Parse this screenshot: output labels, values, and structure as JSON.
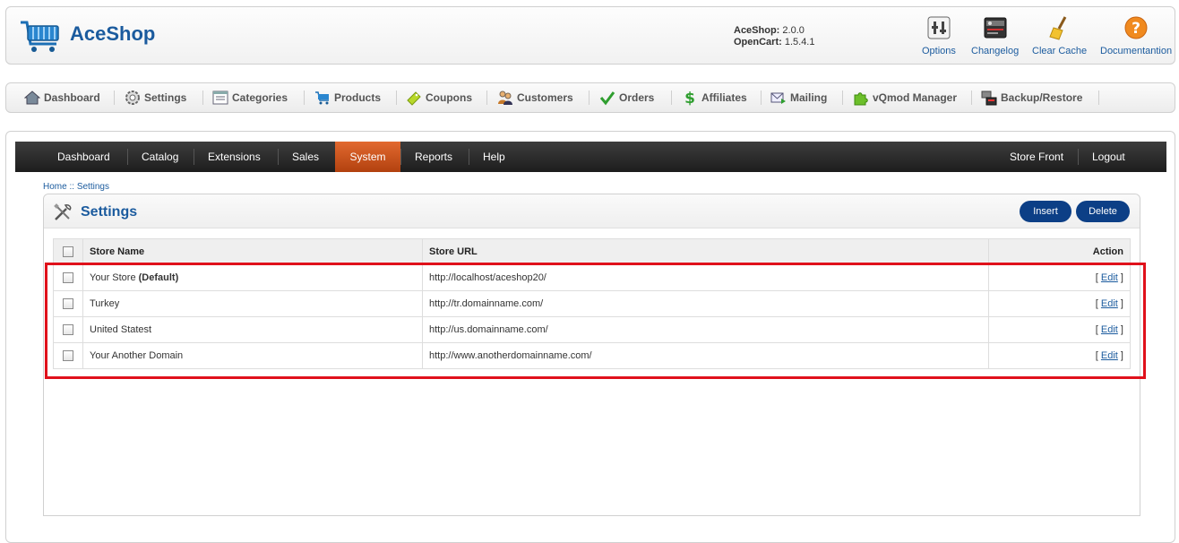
{
  "header": {
    "app_name": "AceShop",
    "aceshop_label": "AceShop:",
    "aceshop_version": "2.0.0",
    "opencart_label": "OpenCart:",
    "opencart_version": "1.5.4.1",
    "buttons": [
      {
        "label": "Options",
        "icon": "options-icon"
      },
      {
        "label": "Changelog",
        "icon": "changelog-icon"
      },
      {
        "label": "Clear Cache",
        "icon": "broom-icon"
      },
      {
        "label": "Documentantion",
        "icon": "help-icon"
      }
    ]
  },
  "toolbar": {
    "items": [
      {
        "label": "Dashboard",
        "icon": "home-icon"
      },
      {
        "label": "Settings",
        "icon": "gear-icon"
      },
      {
        "label": "Categories",
        "icon": "categories-icon"
      },
      {
        "label": "Products",
        "icon": "cart-icon"
      },
      {
        "label": "Coupons",
        "icon": "coupon-icon"
      },
      {
        "label": "Customers",
        "icon": "customers-icon"
      },
      {
        "label": "Orders",
        "icon": "checkmark-icon"
      },
      {
        "label": "Affiliates",
        "icon": "dollar-icon"
      },
      {
        "label": "Mailing",
        "icon": "mail-icon"
      },
      {
        "label": "vQmod Manager",
        "icon": "puzzle-icon"
      },
      {
        "label": "Backup/Restore",
        "icon": "backup-icon"
      }
    ]
  },
  "nav": {
    "items": [
      "Dashboard",
      "Catalog",
      "Extensions",
      "Sales",
      "System",
      "Reports",
      "Help"
    ],
    "active": "System",
    "right_items": [
      "Store Front",
      "Logout"
    ]
  },
  "breadcrumb": {
    "home": "Home",
    "separator": " :: ",
    "current": "Settings"
  },
  "panel": {
    "title": "Settings",
    "insert_label": "Insert",
    "delete_label": "Delete"
  },
  "table": {
    "columns": [
      "Store Name",
      "Store URL",
      "Action"
    ],
    "rows": [
      {
        "name": "Your Store",
        "suffix": "(Default)",
        "url": "http://localhost/aceshop20/",
        "action": "Edit"
      },
      {
        "name": "Turkey",
        "suffix": "",
        "url": "http://tr.domainname.com/",
        "action": "Edit"
      },
      {
        "name": "United Statest",
        "suffix": "",
        "url": "http://us.domainname.com/",
        "action": "Edit"
      },
      {
        "name": "Your Another Domain",
        "suffix": "",
        "url": "http://www.anotherdomainname.com/",
        "action": "Edit"
      }
    ]
  },
  "colors": {
    "brand_blue": "#1b5b9e",
    "nav_active": "#c9511c",
    "button_blue": "#0c3f86",
    "highlight_red": "#e0111b"
  }
}
